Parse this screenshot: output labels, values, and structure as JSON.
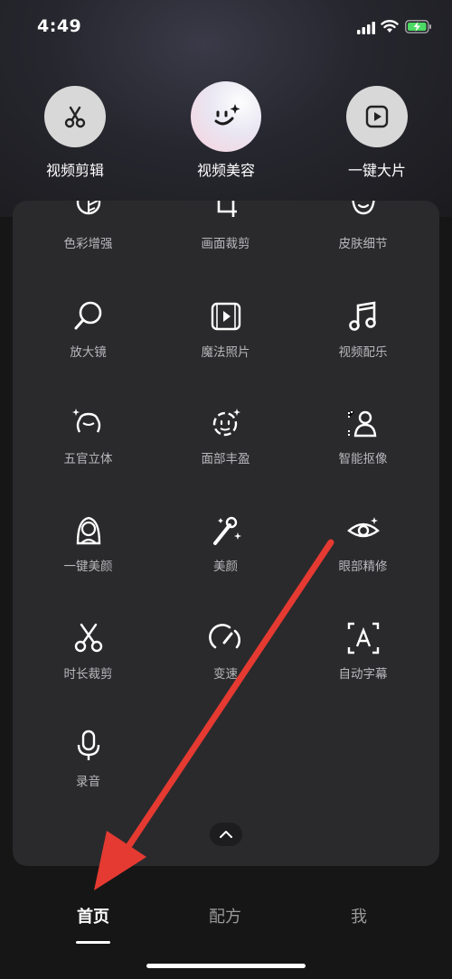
{
  "status": {
    "time": "4:49"
  },
  "top_tools": [
    {
      "label": "视频剪辑",
      "icon": "scissors-icon"
    },
    {
      "label": "视频美容",
      "icon": "smile-sparkle-icon"
    },
    {
      "label": "一键大片",
      "icon": "play-icon"
    }
  ],
  "grid": {
    "row0": [
      {
        "label": "色彩增强",
        "icon": "color-enhance-icon"
      },
      {
        "label": "画面裁剪",
        "icon": "crop-icon"
      },
      {
        "label": "皮肤细节",
        "icon": "face-detail-icon"
      }
    ],
    "row1": [
      {
        "label": "放大镜",
        "icon": "magnifier-icon"
      },
      {
        "label": "魔法照片",
        "icon": "magic-photo-icon"
      },
      {
        "label": "视频配乐",
        "icon": "music-note-icon"
      }
    ],
    "row2": [
      {
        "label": "五官立体",
        "icon": "face-contour-icon"
      },
      {
        "label": "面部丰盈",
        "icon": "face-fill-icon"
      },
      {
        "label": "智能抠像",
        "icon": "cutout-person-icon"
      }
    ],
    "row3": [
      {
        "label": "一键美颜",
        "icon": "beauty-woman-icon"
      },
      {
        "label": "美颜",
        "icon": "magic-wand-icon"
      },
      {
        "label": "眼部精修",
        "icon": "eye-icon"
      }
    ],
    "row4": [
      {
        "label": "时长裁剪",
        "icon": "scissors-icon"
      },
      {
        "label": "变速",
        "icon": "speedometer-icon"
      },
      {
        "label": "自动字幕",
        "icon": "subtitle-icon"
      }
    ],
    "row5": [
      {
        "label": "录音",
        "icon": "microphone-icon"
      }
    ]
  },
  "tabs": [
    {
      "label": "首页"
    },
    {
      "label": "配方"
    },
    {
      "label": "我"
    }
  ],
  "colors": {
    "background": "#161616",
    "panel": "#2a2a2c",
    "annotation_arrow": "#e53a32",
    "battery": "#4cd964"
  }
}
